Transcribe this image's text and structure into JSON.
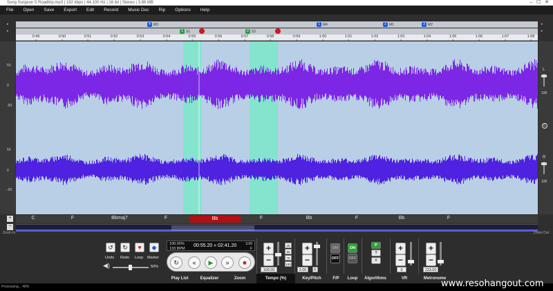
{
  "window": {
    "title": "Song Surgeon 5 Roadtrip.mp3 | 192 kbps | 44,100 Hz | 16 bit | Stereo | 3.86 MB",
    "buttons": [
      "–",
      "☐",
      "✕"
    ]
  },
  "menu": [
    "File",
    "Open",
    "Save",
    "Export",
    "Edit",
    "Record",
    "Music Doc",
    "Rip",
    "Options",
    "Help"
  ],
  "markers": [
    {
      "num": "4",
      "label": "M3",
      "color": "#1e5ad8"
    },
    {
      "num": "1",
      "label": "M4",
      "color": "#1e5ad8"
    },
    {
      "num": "2",
      "label": "M1",
      "color": "#1e5ad8"
    },
    {
      "num": "3",
      "label": "M2",
      "color": "#1e5ad8"
    }
  ],
  "loops": [
    {
      "num": "1",
      "label": "S1",
      "color": "#28a040"
    },
    {
      "num": "2",
      "label": "S2",
      "color": "#28a040"
    }
  ],
  "timeline": [
    "0:49",
    "0:50",
    "0:51",
    "0:52",
    "0:53",
    "0:54",
    "0:55",
    "0:56",
    "0:57",
    "0:58",
    "0:59",
    "1:00",
    "1:01",
    "1:02",
    "1:03",
    "1:04",
    "1:05",
    "1:06",
    "1:07",
    "1:08"
  ],
  "yscale_top": [
    "50",
    "0",
    "-50"
  ],
  "yscale_bottom": [
    "50",
    "0",
    "-50"
  ],
  "right_panel": {
    "left_label": "L",
    "left_val": "100",
    "right_label": "R",
    "right_val": "100",
    "center_label": "C"
  },
  "chords": [
    "C",
    "F",
    "Bbmaj7",
    "F",
    "Bb",
    "F",
    "Bb",
    "F",
    "Bb",
    "F"
  ],
  "active_chord": "Bb",
  "status": {
    "left": "Zoom In",
    "right": "Zoom Out",
    "progress": "Processing... 48%"
  },
  "transport": {
    "undo": "Undo",
    "redo": "Redo",
    "loop": "Loop",
    "marker": "Marker",
    "volume": "50%",
    "lcd_tempo": "100.00%",
    "lcd_bpm": "133 BPM",
    "lcd_time": "00:55.20 » 02:41.20",
    "lcd_right1": "3.00",
    "lcd_right2": "F"
  },
  "modules": {
    "tempo_value": "100.00",
    "key_value": "3.00",
    "key_note": "F",
    "fp_on": "ON",
    "fp_off": "OFF",
    "loop_on": "ON",
    "loop_off": "OFF",
    "algo_p": "P",
    "algo_t": "T",
    "algo_v": "V",
    "vr_value": "0",
    "metronome_value": "133.00",
    "speed_labels": [
      "25",
      "50",
      "75",
      "100"
    ]
  },
  "tabs": [
    "Play List",
    "Equalizer",
    "Zoom",
    "Tempo (%)",
    "Key/Pitch",
    "F/P",
    "Loop",
    "Algorithms",
    "VR",
    "Metronome"
  ],
  "active_tab": "Tempo (%)",
  "watermark": "www.resohangout.com",
  "colors": {
    "wave": "#7a1fe6",
    "wave_bottom": "#4a18e0",
    "loop_region": "#7ae8c8",
    "bg": "#b8cfe6",
    "active_chord": "#b30e12"
  }
}
